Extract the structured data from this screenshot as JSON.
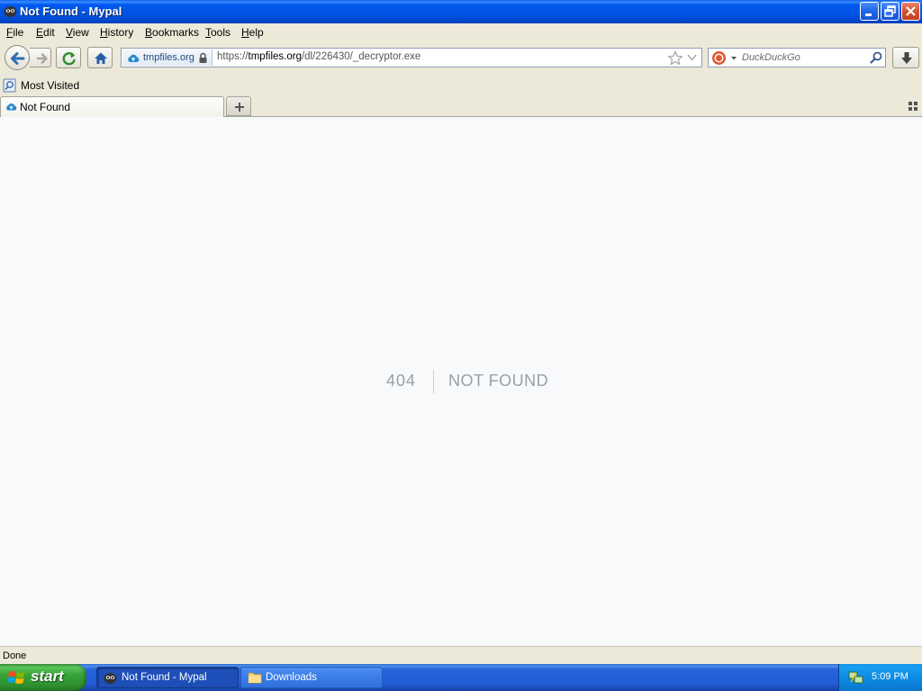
{
  "window": {
    "title": "Not Found - Mypal",
    "buttons": {
      "minimize_icon": "minimize-icon",
      "maximize_icon": "restore-icon",
      "close_icon": "close-icon"
    }
  },
  "menu": {
    "items": [
      {
        "label": "File",
        "accel": "F",
        "rest": "ile"
      },
      {
        "label": "Edit",
        "accel": "E",
        "rest": "dit"
      },
      {
        "label": "View",
        "accel": "V",
        "rest": "iew"
      },
      {
        "label": "History",
        "accel": "H",
        "rest": "istory"
      },
      {
        "label": "Bookmarks",
        "accel": "B",
        "rest": "ookmarks"
      },
      {
        "label": "Tools",
        "accel": "T",
        "rest": "ools"
      },
      {
        "label": "Help",
        "accel": "H",
        "rest": "elp"
      }
    ]
  },
  "navbar": {
    "identity_domain": "tmpfiles.org",
    "url_prefix": "https://",
    "url_host": "tmpfiles.org",
    "url_path": "/dl/226430/_decryptor.exe",
    "search_placeholder": "DuckDuckGo"
  },
  "bookmarks": {
    "items": [
      {
        "label": "Most Visited"
      }
    ]
  },
  "tabs": {
    "items": [
      {
        "label": "Not Found",
        "active": true
      }
    ]
  },
  "page": {
    "error_code": "404",
    "error_message": "NOT FOUND"
  },
  "status": {
    "text": "Done"
  },
  "taskbar": {
    "start_label": "start",
    "tasks": [
      {
        "label": "Not Found - Mypal",
        "active": true
      },
      {
        "label": "Downloads",
        "active": false
      }
    ],
    "clock": "5:09 PM"
  },
  "colors": {
    "titlebar": "#0054e3",
    "chrome": "#ece9d8",
    "content_bg": "#f7f9fb",
    "error_text": "#9aa0a6",
    "taskbar": "#245edb",
    "start_button": "#37a337"
  }
}
